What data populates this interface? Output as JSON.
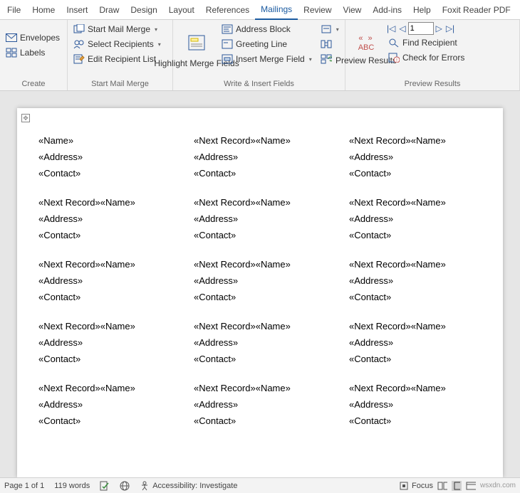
{
  "tabs": [
    "File",
    "Home",
    "Insert",
    "Draw",
    "Design",
    "Layout",
    "References",
    "Mailings",
    "Review",
    "View",
    "Add-ins",
    "Help",
    "Foxit Reader PDF"
  ],
  "active_tab": 7,
  "ribbon": {
    "create": {
      "envelopes": "Envelopes",
      "labels": "Labels",
      "title": "Create"
    },
    "start": {
      "start_merge": "Start Mail Merge",
      "select_rec": "Select Recipients",
      "edit_rec": "Edit Recipient List",
      "title": "Start Mail Merge"
    },
    "write": {
      "highlight": "Highlight Merge Fields",
      "address": "Address Block",
      "greeting": "Greeting Line",
      "insert_field": "Insert Merge Field",
      "title": "Write & Insert Fields"
    },
    "preview": {
      "abc": "ABC",
      "preview": "Preview Results",
      "record": "1",
      "find": "Find Recipient",
      "check": "Check for Errors",
      "title": "Preview Results"
    }
  },
  "doc": {
    "cells": [
      [
        "«Name»",
        "«Address»",
        "«Contact»"
      ],
      [
        "«Next Record»«Name»",
        "«Address»",
        "«Contact»"
      ],
      [
        "«Next Record»«Name»",
        "«Address»",
        "«Contact»"
      ],
      [
        "«Next Record»«Name»",
        "«Address»",
        "«Contact»"
      ],
      [
        "«Next Record»«Name»",
        "«Address»",
        "«Contact»"
      ],
      [
        "«Next Record»«Name»",
        "«Address»",
        "«Contact»"
      ],
      [
        "«Next Record»«Name»",
        "«Address»",
        "«Contact»"
      ],
      [
        "«Next Record»«Name»",
        "«Address»",
        "«Contact»"
      ],
      [
        "«Next Record»«Name»",
        "«Address»",
        "«Contact»"
      ],
      [
        "«Next Record»«Name»",
        "«Address»",
        "«Contact»"
      ],
      [
        "«Next Record»«Name»",
        "«Address»",
        "«Contact»"
      ],
      [
        "«Next Record»«Name»",
        "«Address»",
        "«Contact»"
      ],
      [
        "«Next Record»«Name»",
        "«Address»",
        "«Contact»"
      ],
      [
        "«Next Record»«Name»",
        "«Address»",
        "«Contact»"
      ],
      [
        "«Next Record»«Name»",
        "«Address»",
        "«Contact»"
      ]
    ]
  },
  "status": {
    "page": "Page 1 of 1",
    "words": "119 words",
    "acc": "Accessibility: Investigate",
    "focus": "Focus",
    "site": "wsxdn.com"
  }
}
